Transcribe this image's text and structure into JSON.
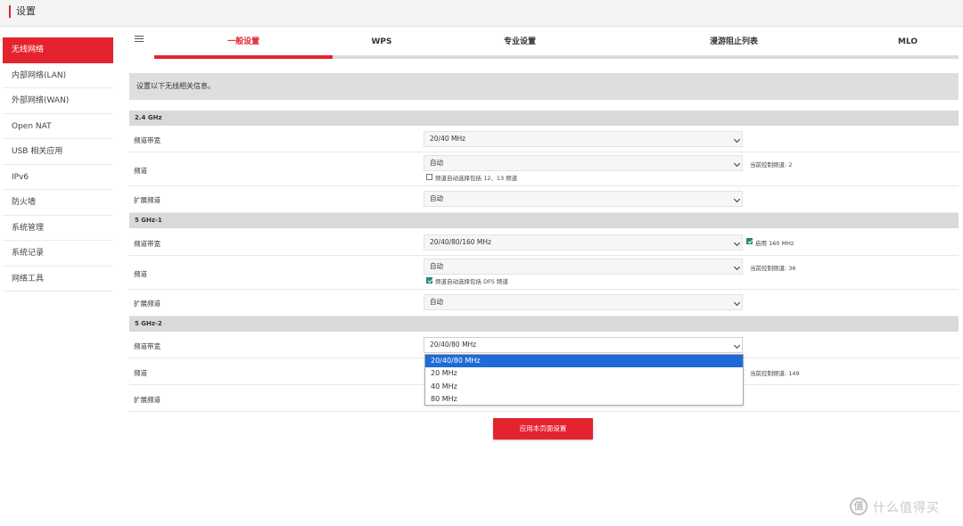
{
  "header": {
    "title": "设置"
  },
  "sidebar": {
    "items": [
      {
        "label": "无线网络",
        "active": true
      },
      {
        "label": "内部网络(LAN)"
      },
      {
        "label": "外部网络(WAN)"
      },
      {
        "label": "Open NAT"
      },
      {
        "label": "USB 相关应用"
      },
      {
        "label": "IPv6"
      },
      {
        "label": "防火墙"
      },
      {
        "label": "系统管理"
      },
      {
        "label": "系统记录"
      },
      {
        "label": "网络工具"
      }
    ]
  },
  "tabs": [
    {
      "label": "一般设置",
      "active": true
    },
    {
      "label": "WPS"
    },
    {
      "label": "专业设置"
    },
    {
      "label": "漫游阻止列表"
    },
    {
      "label": "MLO"
    }
  ],
  "info": {
    "text": "设置以下无线相关信息。"
  },
  "bands": [
    {
      "name": "2.4 GHz",
      "bandwidth": {
        "label": "频道带宽",
        "value": "20/40 MHz"
      },
      "channel": {
        "label": "频道",
        "value": "自动",
        "checkbox_label": "频道自动选择包括 12、13 频道",
        "checked": false,
        "note": "当前控制频道: 2"
      },
      "ext_channel": {
        "label": "扩展频道",
        "value": "自动"
      }
    },
    {
      "name": "5 GHz-1",
      "bandwidth": {
        "label": "频道带宽",
        "value": "20/40/80/160 MHz",
        "checkbox_label": "启用 160 MHz",
        "checked": true
      },
      "channel": {
        "label": "频道",
        "value": "自动",
        "checkbox_label": "频道自动选择包括 DFS 频道",
        "checked": true,
        "note": "当前控制频道: 36"
      },
      "ext_channel": {
        "label": "扩展频道",
        "value": "自动"
      }
    },
    {
      "name": "5 GHz-2",
      "bandwidth": {
        "label": "频道带宽",
        "value": "20/40/80 MHz"
      },
      "channel": {
        "label": "频道",
        "note": "当前控制频道: 149"
      },
      "ext_channel": {
        "label": "扩展频道"
      }
    }
  ],
  "dropdown": {
    "options": [
      "20/40/80 MHz",
      "20 MHz",
      "40 MHz",
      "80 MHz"
    ],
    "highlighted_index": 0
  },
  "apply_button": {
    "label": "应用本页面设置"
  },
  "watermark": {
    "logo_glyph": "值",
    "text": "什么值得买"
  },
  "colors": {
    "accent": "#e5232f",
    "highlight": "#1e6ad8",
    "checkbox": "#1c8c77"
  },
  "icons": {
    "tab_menu": "list-icon",
    "select_arrow": "chevron-down-icon",
    "checkbox": "checkbox-icon"
  }
}
